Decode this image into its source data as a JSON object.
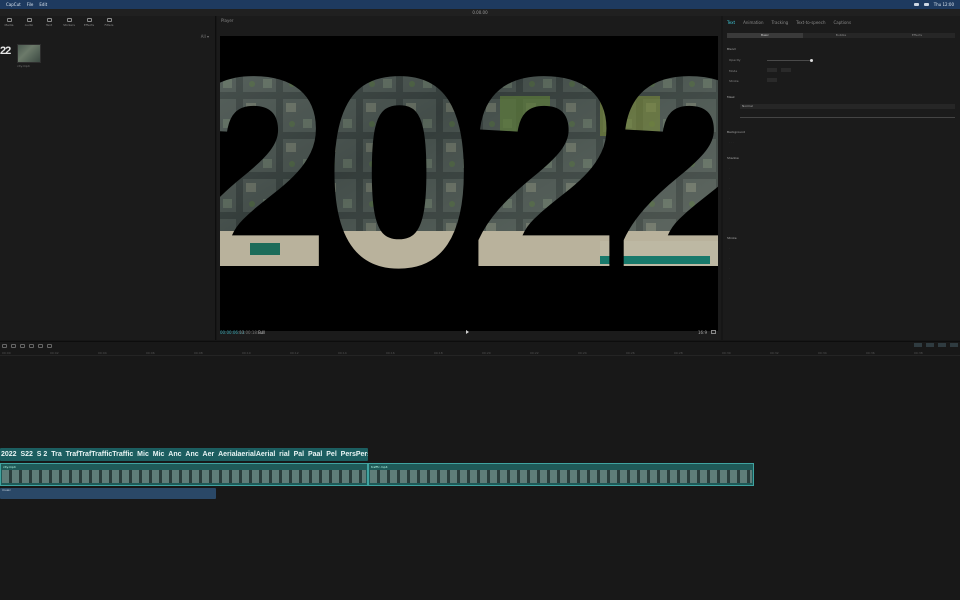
{
  "menubar": {
    "app": "CapCut",
    "items": [
      "File",
      "Edit"
    ],
    "status": "Thu 12:00"
  },
  "window": {
    "title": "0.00.00"
  },
  "media": {
    "tabs": [
      "Media",
      "Audio",
      "Text",
      "Stickers",
      "Effects",
      "Filters"
    ],
    "sub_label": "All  ▾",
    "thumb_text": "22",
    "thumb_caption": "city.mp4"
  },
  "player": {
    "title": "Player",
    "big_text": "2022",
    "timecode_current": "00:00:06:13",
    "timecode_total": "00:00:18:24",
    "extra": "Full",
    "ratio": "16:9"
  },
  "inspector": {
    "tabs": [
      "Text",
      "Animation",
      "Tracking",
      "Text-to-speech",
      "Captions"
    ],
    "segments": [
      "Basic",
      "Bubble",
      "Effects"
    ],
    "section_style": "Blend",
    "row_opacity": "Opacity",
    "row_mode": "Mode",
    "row_stroke": "Stroke",
    "section_blend": "Mask",
    "dropdown_value": "Normal",
    "section_a": "Background",
    "section_b": "Shadow",
    "section_c": "Stroke"
  },
  "timeline": {
    "ruler": [
      "00:00",
      "00:02",
      "00:04",
      "00:06",
      "00:08",
      "00:10",
      "00:12",
      "00:14",
      "00:16",
      "00:18",
      "00:20",
      "00:22",
      "00:24",
      "00:26",
      "00:28",
      "00:30",
      "00:32",
      "00:34",
      "00:36",
      "00:38"
    ],
    "text_clip": "2022  S22  S 2  Tra  TrafTrafTrafficTraffic  Mic  Mic  Anc  Anc  Aer  AerialaerialAerial  rial  Pal  Paal  Pel  PersPersperspersperspersectiveclock",
    "clip1_label": "city.mp4",
    "clip2_label": "traffic.mp4",
    "audio_label": "music"
  },
  "colors": {
    "accent": "#3ec7d6",
    "track_text": "#1c5e60",
    "track_video": "#1f5a58",
    "track_audio": "#2a4867"
  }
}
